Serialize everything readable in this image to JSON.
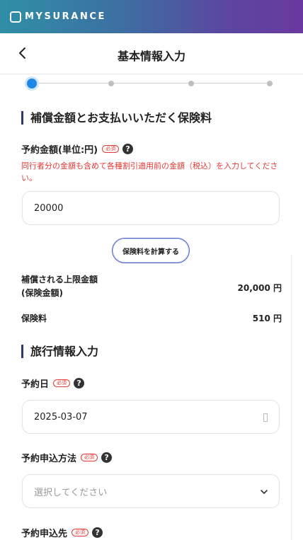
{
  "brand": {
    "name": "MYSURANCE"
  },
  "nav": {
    "title": "基本情報入力",
    "back_icon": "chevron-left-icon"
  },
  "stepper": {
    "current_step": 1,
    "total_steps": 4
  },
  "section_coverage": {
    "title": "補償金額とお支払いいただく保険料",
    "amount_label": "予約金額(単位:円)",
    "required_badge": "必須",
    "note": "同行者分の金額も含めて各種割引適用前の金額（税込）を入力してください。",
    "amount_value": "20000",
    "calc_button": "保険料を計算する",
    "limit_label_line1": "補償される上限金額",
    "limit_label_line2": "(保険金額)",
    "limit_value": "20,000 円",
    "premium_label": "保険料",
    "premium_value": "510 円"
  },
  "section_travel": {
    "title": "旅行情報入力",
    "date_label": "予約日",
    "date_value": "2025-03-07",
    "method_label": "予約申込方法",
    "method_placeholder": "選択してください",
    "dest_label": "予約申込先",
    "required_badge": "必須"
  },
  "colors": {
    "accent_blue": "#1e88e5",
    "required_red": "#e53935",
    "section_bar": "#2c3a7a"
  }
}
